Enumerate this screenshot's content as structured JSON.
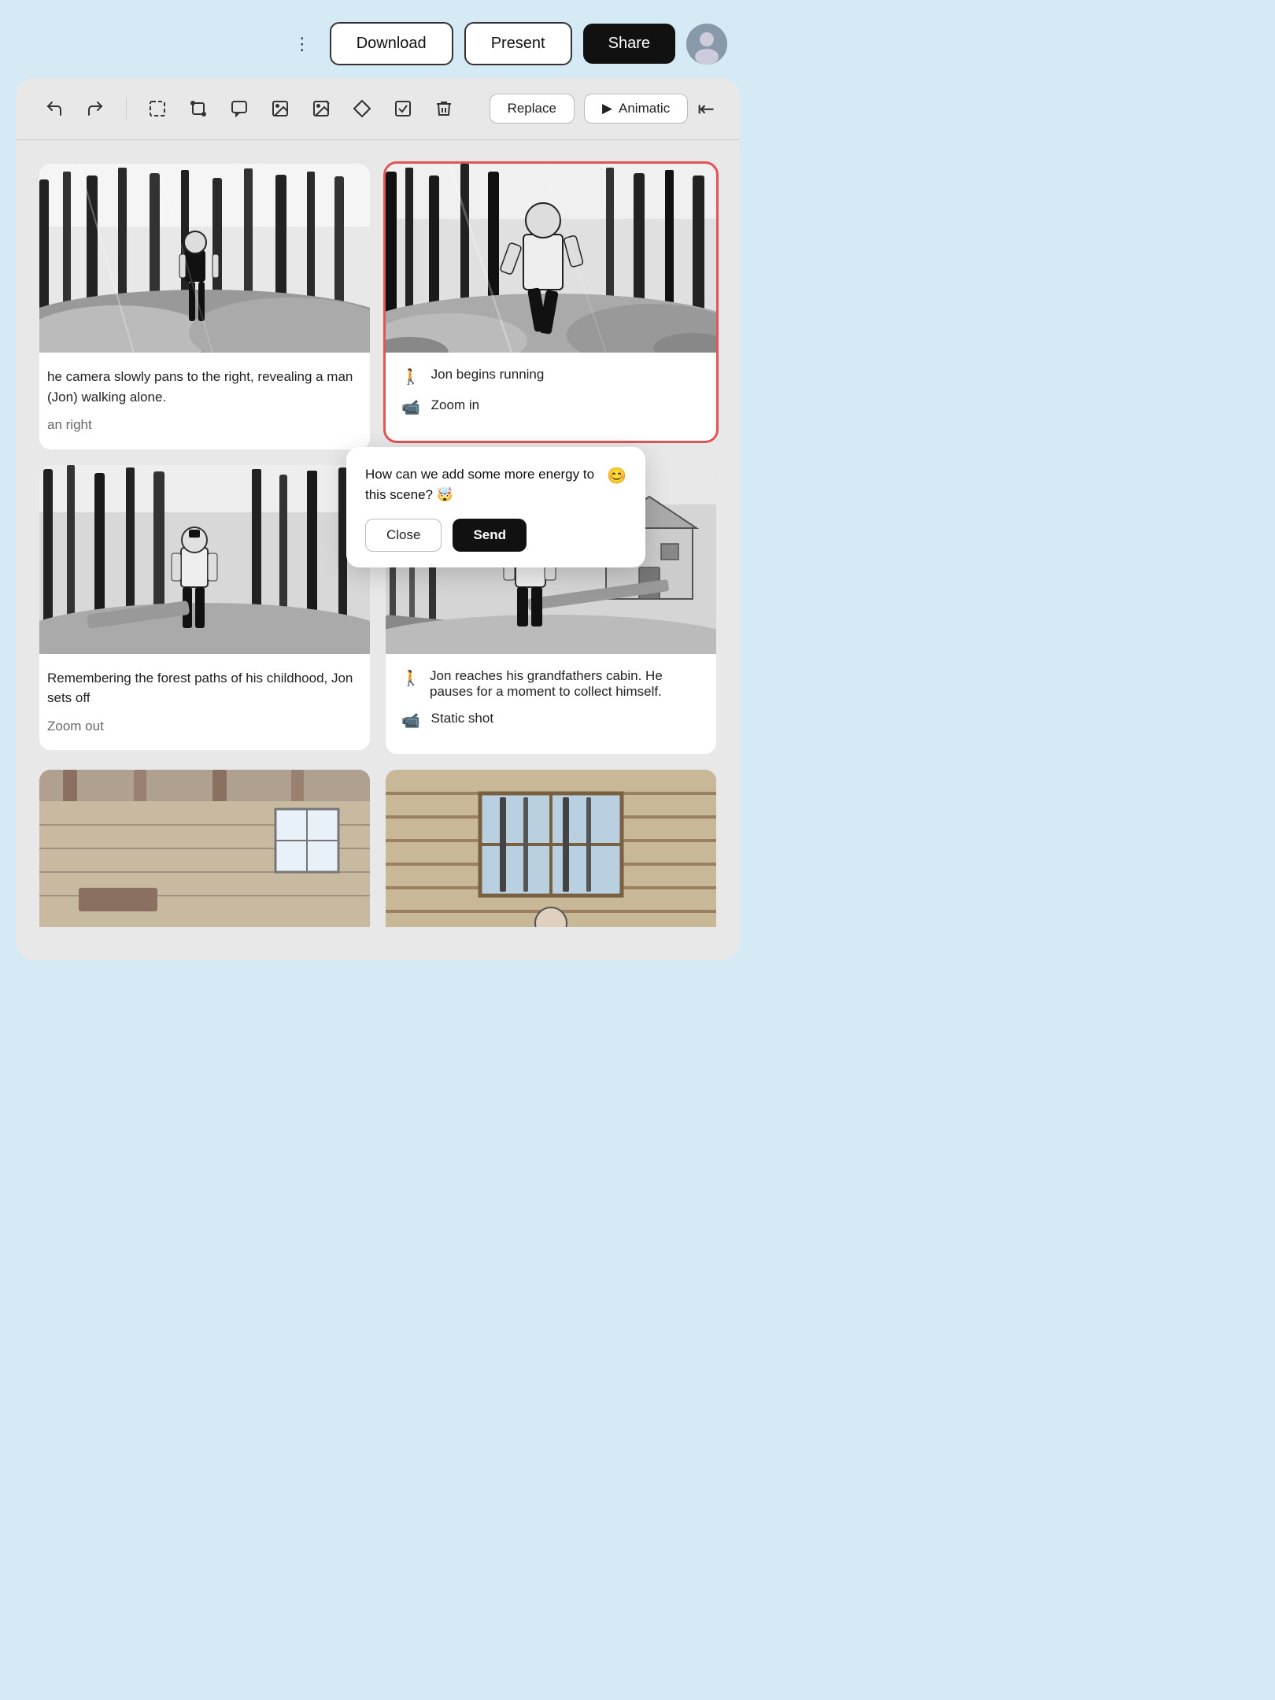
{
  "header": {
    "more_icon": "⋮",
    "download_label": "Download",
    "present_label": "Present",
    "share_label": "Share"
  },
  "toolbar": {
    "undo_icon": "↩",
    "redo_icon": "↪",
    "replace_label": "Replace",
    "animatic_label": "Animatic",
    "back_icon": "⇤"
  },
  "panels": [
    {
      "id": "panel-1",
      "selected": false,
      "description": "The camera slowly pans to the right, revealing a man (Jon) walking alone.",
      "direction": "Pan right",
      "actions": []
    },
    {
      "id": "panel-2",
      "selected": true,
      "description": "",
      "actions": [
        {
          "icon": "🚶",
          "text": "Jon begins running"
        },
        {
          "icon": "📹",
          "text": "Zoom in"
        }
      ]
    },
    {
      "id": "panel-3",
      "selected": false,
      "description": "Remembering the forest paths of his childhood, Jon sets off",
      "direction": "Zoom out",
      "actions": []
    },
    {
      "id": "panel-4",
      "selected": false,
      "description": "",
      "actions": [
        {
          "icon": "🚶",
          "text": "Jon reaches his grandfathers cabin. He pauses for a moment to collect himself."
        },
        {
          "icon": "📹",
          "text": "Static shot"
        }
      ]
    }
  ],
  "comment_popup": {
    "text": "How can we add some more energy to this scene? 🤯",
    "emoji_icon": "😊",
    "close_label": "Close",
    "send_label": "Send"
  }
}
